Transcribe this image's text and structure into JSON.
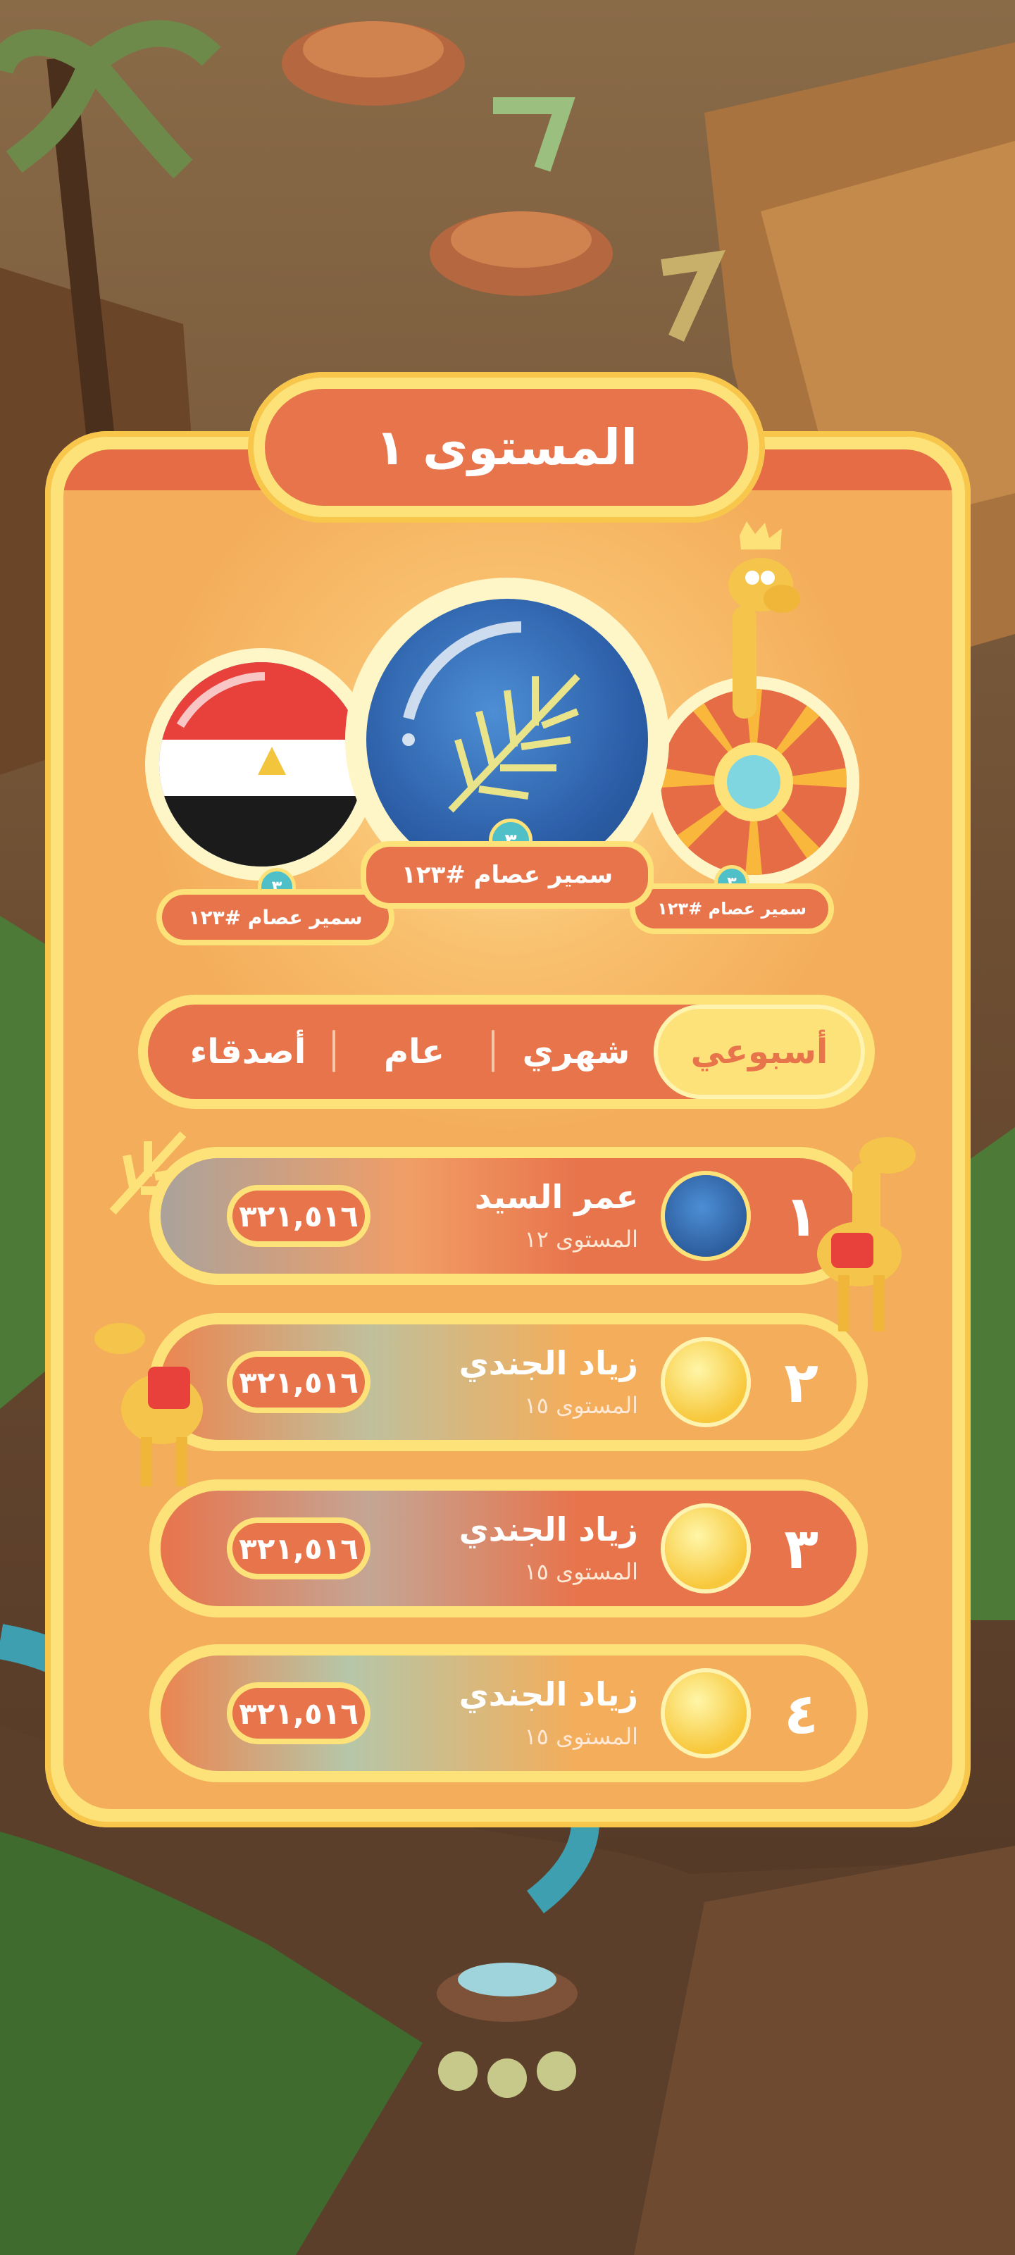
{
  "title": "المستوى ١",
  "podium": [
    {
      "position": "left",
      "name": "سمير عصام #١٢٣",
      "level": "٣"
    },
    {
      "position": "center",
      "name": "سمير عصام #١٢٣",
      "level": "٣"
    },
    {
      "position": "right",
      "name": "سمير عصام #١٢٣",
      "level": "٣"
    }
  ],
  "tabs": [
    {
      "label": "أسبوعي",
      "active": true
    },
    {
      "label": "شهري",
      "active": false
    },
    {
      "label": "عام",
      "active": false
    },
    {
      "label": "أصدقاء",
      "active": false
    }
  ],
  "rows": [
    {
      "rank": "١",
      "name": "عمر السيد",
      "level": "المستوى ١٢",
      "score": "٣٢١,٥١٦",
      "avatar": "palm-leaf-icon"
    },
    {
      "rank": "٢",
      "name": "زياد الجندي",
      "level": "المستوى ١٥",
      "score": "٣٢١,٥١٦",
      "avatar": "yellow-orb-icon"
    },
    {
      "rank": "٣",
      "name": "زياد الجندي",
      "level": "المستوى ١٥",
      "score": "٣٢١,٥١٦",
      "avatar": "yellow-orb-icon"
    },
    {
      "rank": "٤",
      "name": "زياد الجندي",
      "level": "المستوى ١٥",
      "score": "٣٢١,٥١٦",
      "avatar": "yellow-orb-icon"
    }
  ],
  "colors": {
    "panel": "#f4ad5a",
    "accent": "#e8744c",
    "gold": "#fde27a",
    "teal": "#4fc0c7"
  }
}
